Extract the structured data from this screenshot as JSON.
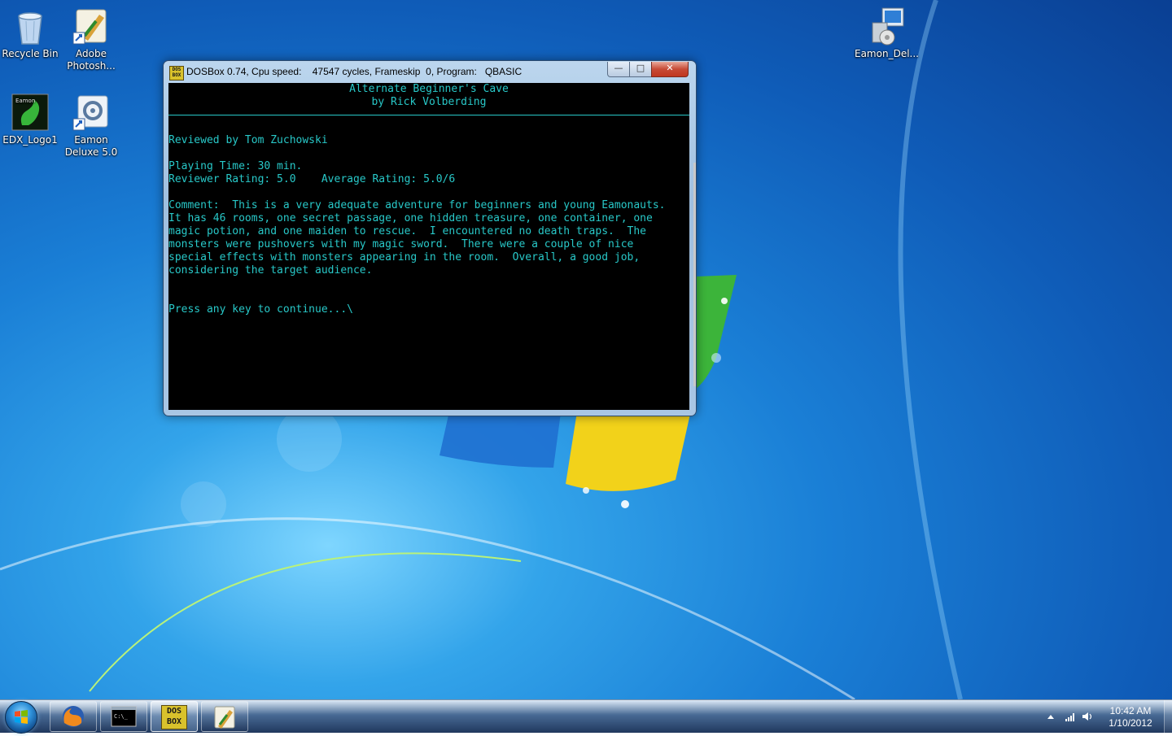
{
  "desktop": {
    "icons": [
      {
        "label": "Recycle Bin",
        "icon": "recycle-bin-icon"
      },
      {
        "label": "Adobe Photosh...",
        "icon": "photoshop-shortcut-icon"
      },
      {
        "label": "EDX_Logo1",
        "icon": "eamon-logo-image-icon"
      },
      {
        "label": "Eamon Deluxe 5.0",
        "icon": "eamon-deluxe-shortcut-icon"
      },
      {
        "label": "Eamon_Del...",
        "icon": "installer-icon"
      }
    ]
  },
  "dosbox": {
    "title": "DOSBox 0.74, Cpu speed:    47547 cycles, Frameskip  0, Program:   QBASIC",
    "app_icon_text": "DOS BOX",
    "buttons": {
      "minimize": "—",
      "maximize": "□",
      "close": "✕"
    },
    "screen": {
      "title_line1": "Alternate Beginner's Cave",
      "title_line2": "by Rick Volberding",
      "reviewer": "Reviewed by Tom Zuchowski",
      "playing_time": "Playing Time: 30 min.",
      "ratings": "Reviewer Rating: 5.0    Average Rating: 5.0/6",
      "comment_lines": [
        "Comment:  This is a very adequate adventure for beginners and young Eamonauts.",
        "It has 46 rooms, one secret passage, one hidden treasure, one container, one",
        "magic potion, and one maiden to rescue.  I encountered no death traps.  The",
        "monsters were pushovers with my magic sword.  There were a couple of nice",
        "special effects with monsters appearing in the room.  Overall, a good job,",
        "considering the target audience."
      ],
      "prompt": "Press any key to continue...\\"
    }
  },
  "taskbar": {
    "buttons": [
      {
        "icon": "firefox-icon"
      },
      {
        "icon": "command-prompt-icon"
      },
      {
        "icon": "dosbox-icon",
        "text": "DOS BOX"
      },
      {
        "icon": "eamon-editor-icon"
      }
    ],
    "clock_time": "10:42 AM",
    "clock_date": "1/10/2012"
  },
  "colors": {
    "dos_text": "#28c8c8",
    "desktop_blue": "#1a7fd6"
  }
}
